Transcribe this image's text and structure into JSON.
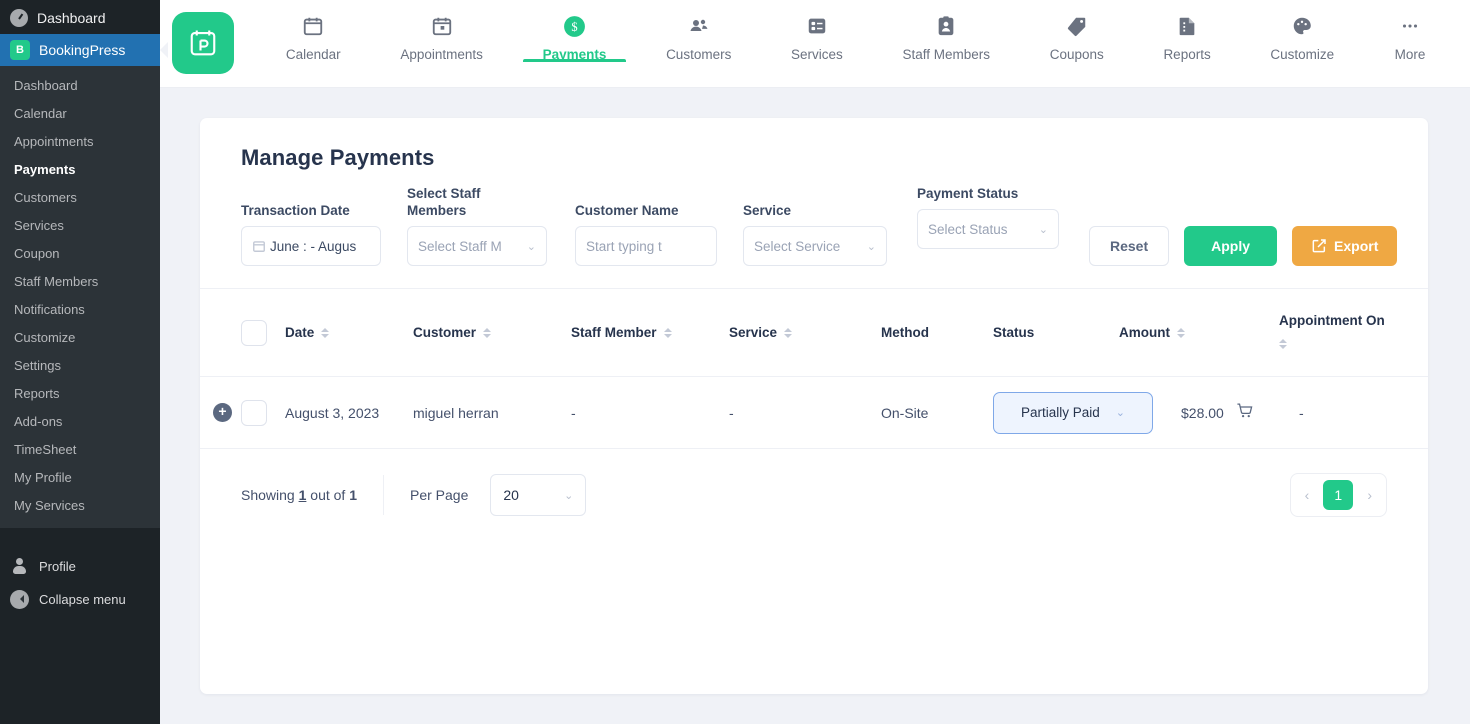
{
  "wp_sidebar": {
    "dashboard_label": "Dashboard",
    "brand_label": "BookingPress",
    "items": [
      {
        "label": "Dashboard",
        "active": false
      },
      {
        "label": "Calendar",
        "active": false
      },
      {
        "label": "Appointments",
        "active": false
      },
      {
        "label": "Payments",
        "active": true
      },
      {
        "label": "Customers",
        "active": false
      },
      {
        "label": "Services",
        "active": false
      },
      {
        "label": "Coupon",
        "active": false
      },
      {
        "label": "Staff Members",
        "active": false
      },
      {
        "label": "Notifications",
        "active": false
      },
      {
        "label": "Customize",
        "active": false
      },
      {
        "label": "Settings",
        "active": false
      },
      {
        "label": "Reports",
        "active": false
      },
      {
        "label": "Add-ons",
        "active": false
      },
      {
        "label": "TimeSheet",
        "active": false
      },
      {
        "label": "My Profile",
        "active": false
      },
      {
        "label": "My Services",
        "active": false
      }
    ],
    "profile_label": "Profile",
    "collapse_label": "Collapse menu"
  },
  "topnav": {
    "items": [
      {
        "label": "Calendar",
        "icon": "calendar-icon",
        "active": false
      },
      {
        "label": "Appointments",
        "icon": "appointments-icon",
        "active": false
      },
      {
        "label": "Payments",
        "icon": "dollar-coin-icon",
        "active": true
      },
      {
        "label": "Customers",
        "icon": "customers-icon",
        "active": false
      },
      {
        "label": "Services",
        "icon": "services-icon",
        "active": false
      },
      {
        "label": "Staff Members",
        "icon": "staff-badge-icon",
        "active": false
      },
      {
        "label": "Coupons",
        "icon": "tag-icon",
        "active": false
      },
      {
        "label": "Reports",
        "icon": "report-doc-icon",
        "active": false
      },
      {
        "label": "Customize",
        "icon": "palette-icon",
        "active": false
      },
      {
        "label": "More",
        "icon": "ellipsis-icon",
        "active": false
      }
    ]
  },
  "page": {
    "title": "Manage Payments"
  },
  "filters": {
    "transaction_date": {
      "label": "Transaction Date",
      "value": "June : - Augus"
    },
    "staff_members": {
      "label": "Select Staff Members",
      "placeholder": "Select Staff M"
    },
    "customer_name": {
      "label": "Customer Name",
      "placeholder": "Start typing t"
    },
    "service": {
      "label": "Service",
      "placeholder": "Select Service"
    },
    "payment_status": {
      "label": "Payment Status",
      "placeholder": "Select Status"
    },
    "reset_label": "Reset",
    "apply_label": "Apply",
    "export_label": "Export"
  },
  "table": {
    "columns": [
      {
        "key": "date",
        "label": "Date",
        "sortable": true
      },
      {
        "key": "customer",
        "label": "Customer",
        "sortable": true
      },
      {
        "key": "staff_member",
        "label": "Staff Member",
        "sortable": true
      },
      {
        "key": "service",
        "label": "Service",
        "sortable": true
      },
      {
        "key": "method",
        "label": "Method",
        "sortable": false
      },
      {
        "key": "status",
        "label": "Status",
        "sortable": false
      },
      {
        "key": "amount",
        "label": "Amount",
        "sortable": true
      },
      {
        "key": "appointment_on",
        "label": "Appointment On",
        "sortable": true
      }
    ],
    "rows": [
      {
        "date": "August 3, 2023",
        "customer": "miguel herran",
        "staff_member": "-",
        "service": "-",
        "method": "On-Site",
        "status": "Partially Paid",
        "amount": "$28.00",
        "appointment_on": "-"
      }
    ]
  },
  "footer": {
    "showing_prefix": "Showing ",
    "showing_current": "1",
    "showing_mid": " out of ",
    "showing_total": "1",
    "per_page_label": "Per Page",
    "per_page_value": "20",
    "prev_label": "‹",
    "next_label": "›",
    "page_number": "1"
  },
  "colors": {
    "accent_green": "#22c98a",
    "export_orange": "#efa843",
    "wp_blue": "#2271b1",
    "status_border": "#7fa8e8",
    "status_bg": "#eef4fe"
  }
}
